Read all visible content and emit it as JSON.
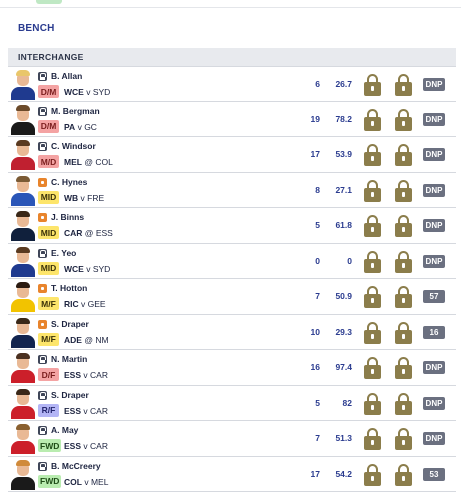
{
  "bench_label": "BENCH",
  "section_label": "INTERCHANGE",
  "players": [
    {
      "name": "B. Allan",
      "tag": "lock",
      "pos": "D/M",
      "pos_class": "dm",
      "team": "WCE",
      "sep": "v",
      "opp": "SYD",
      "games": "6",
      "avg": "26.7",
      "score": "DNP",
      "hair": "#e9c66a",
      "jersey": "#1f3a8f"
    },
    {
      "name": "M. Bergman",
      "tag": "lock",
      "pos": "D/M",
      "pos_class": "dm",
      "team": "PA",
      "sep": "v",
      "opp": "GC",
      "games": "19",
      "avg": "78.2",
      "score": "DNP",
      "hair": "#6b4a2a",
      "jersey": "#1a1a1a"
    },
    {
      "name": "C. Windsor",
      "tag": "lock",
      "pos": "M/D",
      "pos_class": "md",
      "team": "MEL",
      "sep": "@",
      "opp": "COL",
      "games": "17",
      "avg": "53.9",
      "score": "DNP",
      "hair": "#5a3a20",
      "jersey": "#c02030"
    },
    {
      "name": "C. Hynes",
      "tag": "flag",
      "pos": "MID",
      "pos_class": "mid",
      "team": "WB",
      "sep": "v",
      "opp": "FRE",
      "games": "8",
      "avg": "27.1",
      "score": "DNP",
      "hair": "#7a5a35",
      "jersey": "#2a56b8"
    },
    {
      "name": "J. Binns",
      "tag": "flag",
      "pos": "MID",
      "pos_class": "mid",
      "team": "CAR",
      "sep": "@",
      "opp": "ESS",
      "games": "5",
      "avg": "61.8",
      "score": "DNP",
      "hair": "#3a2818",
      "jersey": "#10203c"
    },
    {
      "name": "E. Yeo",
      "tag": "lock",
      "pos": "MID",
      "pos_class": "mid",
      "team": "WCE",
      "sep": "v",
      "opp": "SYD",
      "games": "0",
      "avg": "0",
      "score": "DNP",
      "hair": "#5a3a20",
      "jersey": "#1f3a8f"
    },
    {
      "name": "T. Hotton",
      "tag": "flag",
      "pos": "M/F",
      "pos_class": "mf",
      "team": "RIC",
      "sep": "v",
      "opp": "GEE",
      "games": "7",
      "avg": "50.9",
      "score": "57",
      "hair": "#2a1a10",
      "jersey": "#f2c300"
    },
    {
      "name": "S. Draper",
      "tag": "flag",
      "pos": "M/F",
      "pos_class": "mf",
      "team": "ADE",
      "sep": "@",
      "opp": "NM",
      "games": "10",
      "avg": "29.3",
      "score": "16",
      "hair": "#3a2818",
      "jersey": "#12244f"
    },
    {
      "name": "N. Martin",
      "tag": "lock",
      "pos": "D/F",
      "pos_class": "df",
      "team": "ESS",
      "sep": "v",
      "opp": "CAR",
      "games": "16",
      "avg": "97.4",
      "score": "DNP",
      "hair": "#4a3020",
      "jersey": "#cc1f2a"
    },
    {
      "name": "S. Draper",
      "tag": "lock",
      "pos": "R/F",
      "pos_class": "rf",
      "team": "ESS",
      "sep": "v",
      "opp": "CAR",
      "games": "5",
      "avg": "82",
      "score": "DNP",
      "hair": "#3a2818",
      "jersey": "#cc1f2a"
    },
    {
      "name": "A. May",
      "tag": "lock",
      "pos": "FWD",
      "pos_class": "fwd",
      "team": "ESS",
      "sep": "v",
      "opp": "CAR",
      "games": "7",
      "avg": "51.3",
      "score": "DNP",
      "hair": "#8a6030",
      "jersey": "#cc1f2a"
    },
    {
      "name": "B. McCreery",
      "tag": "lock",
      "pos": "FWD",
      "pos_class": "fwd",
      "team": "COL",
      "sep": "v",
      "opp": "MEL",
      "games": "17",
      "avg": "54.2",
      "score": "53",
      "hair": "#d08a3a",
      "jersey": "#1a1a1a"
    }
  ],
  "colors": {
    "lock_gold": "#8b7d4b",
    "score_badge": "#6b7080",
    "header_blue": "#2a3b8f"
  }
}
